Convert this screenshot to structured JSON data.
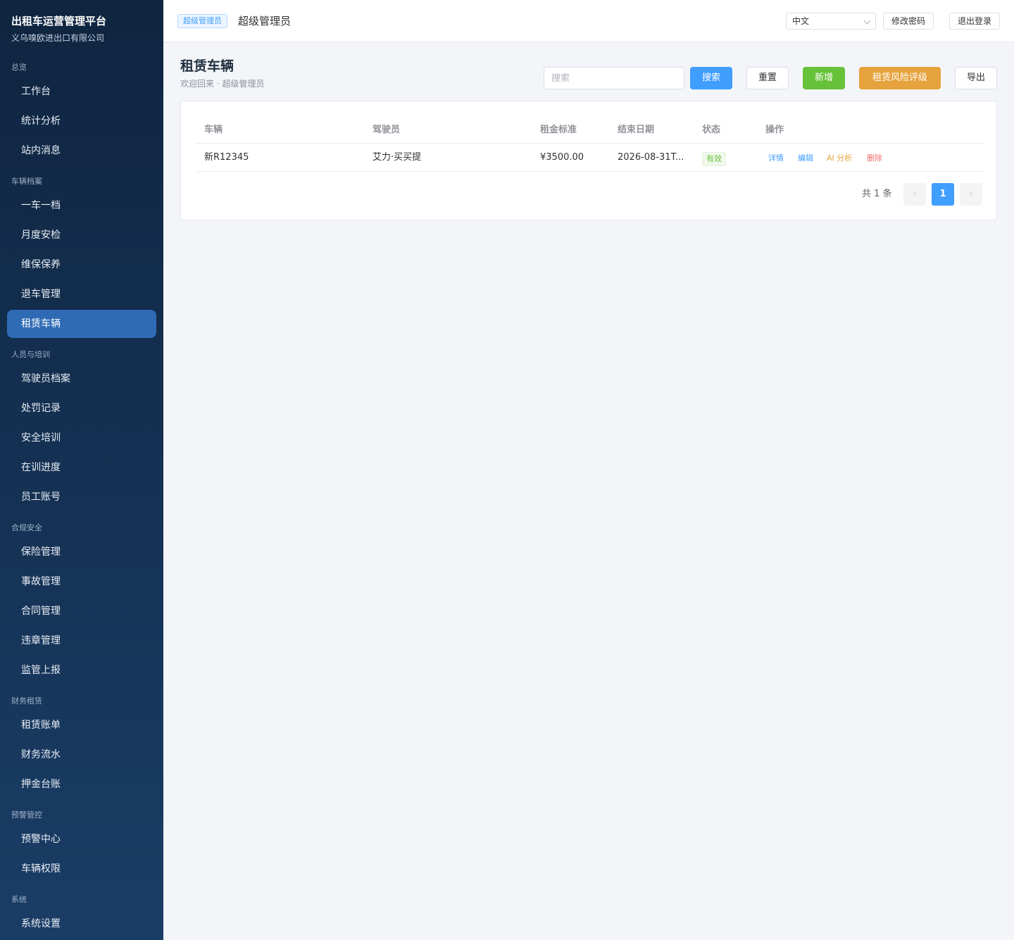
{
  "app": {
    "title": "出租车运营管理平台",
    "company": "义乌嗅欧进出口有限公司"
  },
  "sidebar": {
    "groups": {
      "overview": "总览",
      "vehicle_files": "车辆档案",
      "staff_training": "人员与培训",
      "compliance": "合规安全",
      "finance": "财务租赁",
      "alert": "预警管控",
      "system": "系统"
    },
    "items": {
      "workbench": "工作台",
      "statistics": "统计分析",
      "messages": "站内消息",
      "vehicle_profile": "一车一档",
      "monthly_inspection": "月度安检",
      "maintenance": "维保保养",
      "vehicle_return": "退车管理",
      "rental_vehicles": "租赁车辆",
      "driver_files": "驾驶员档案",
      "penalty_records": "处罚记录",
      "safety_training": "安全培训",
      "training_progress": "在训进度",
      "staff_accounts": "员工账号",
      "insurance": "保险管理",
      "accidents": "事故管理",
      "contracts": "合同管理",
      "violations": "违章管理",
      "regulatory_report": "监管上报",
      "rental_bills": "租赁账单",
      "finance_flow": "财务流水",
      "deposit_ledger": "押金台账",
      "alert_center": "预警中心",
      "vehicle_permissions": "车辆权限",
      "system_settings": "系统设置"
    },
    "active": "租赁车辆"
  },
  "topbar": {
    "role_tag": "超级管理员",
    "user_name": "超级管理员",
    "language": "中文",
    "change_password": "修改密码",
    "logout": "退出登录"
  },
  "page": {
    "title": "租赁车辆",
    "subtitle": "欢迎回来 · 超级管理员",
    "search_placeholder": "搜索",
    "search_btn": "搜索",
    "reset_btn": "重置",
    "add_btn": "新增",
    "risk_btn": "租赁风险评级",
    "export_btn": "导出"
  },
  "table": {
    "headers": {
      "vehicle": "车辆",
      "driver": "驾驶员",
      "rent": "租金标准",
      "end_date": "结束日期",
      "status": "状态",
      "actions": "操作"
    },
    "rows": [
      {
        "vehicle": "新R12345",
        "driver": "艾力·买买提",
        "rent": "¥3500.00",
        "end_date": "2026-08-31T...",
        "status": "有效",
        "actions": {
          "detail": "详情",
          "edit": "编辑",
          "ai": "AI 分析",
          "delete": "删除"
        }
      }
    ]
  },
  "pagination": {
    "total": "共 1 条",
    "prev": "‹",
    "current": "1",
    "next": "›"
  },
  "colors": {
    "sidebar_top": "#0f2540",
    "sidebar_bottom": "#1a3d66",
    "active_item": "#2f6bb5",
    "primary": "#409eff",
    "success": "#67c23a",
    "warning": "#e6a23c",
    "danger": "#f56c6c"
  }
}
